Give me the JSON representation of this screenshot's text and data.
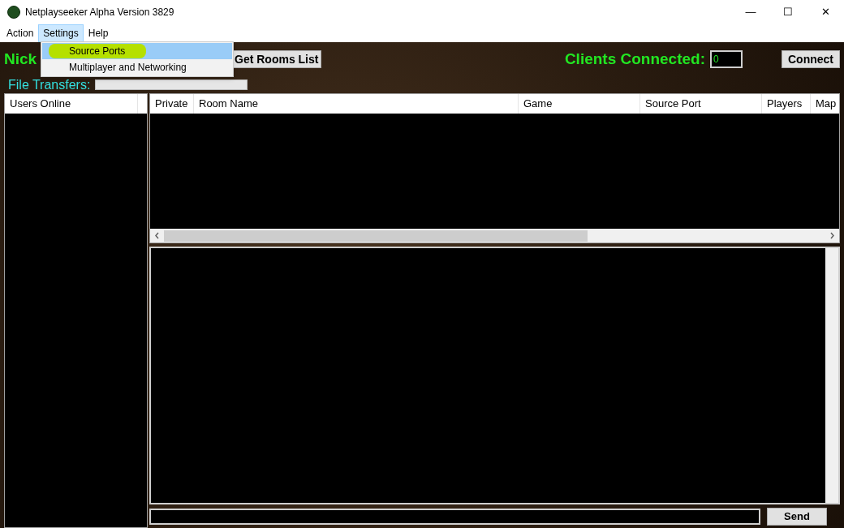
{
  "window": {
    "title": "Netplayseeker Alpha Version 3829",
    "controls": [
      "—",
      "☐",
      "✕"
    ]
  },
  "menu": [
    {
      "label": "Action",
      "selected": false
    },
    {
      "label": "Settings",
      "selected": true
    },
    {
      "label": "Help",
      "selected": false
    }
  ],
  "dropdown": [
    {
      "label": "Source Ports",
      "selected": true
    },
    {
      "label": "Multiplayer and Networking",
      "selected": false
    }
  ],
  "header": {
    "nick_label": "Nick",
    "get_rooms_button": "Get Rooms List",
    "file_transfers_label": "File Transfers:",
    "file_transfers_progress": {
      "level": 0
    },
    "clients_label": "Clients Connected:",
    "clients_value": "0",
    "connect_button": "Connect"
  },
  "users_panel": {
    "columns": [
      "Users Online"
    ]
  },
  "rooms_table": {
    "columns": [
      "Private",
      "Room Name",
      "Game",
      "Source Port",
      "Players",
      "Map"
    ]
  },
  "chat": {
    "send_button": "Send"
  }
}
